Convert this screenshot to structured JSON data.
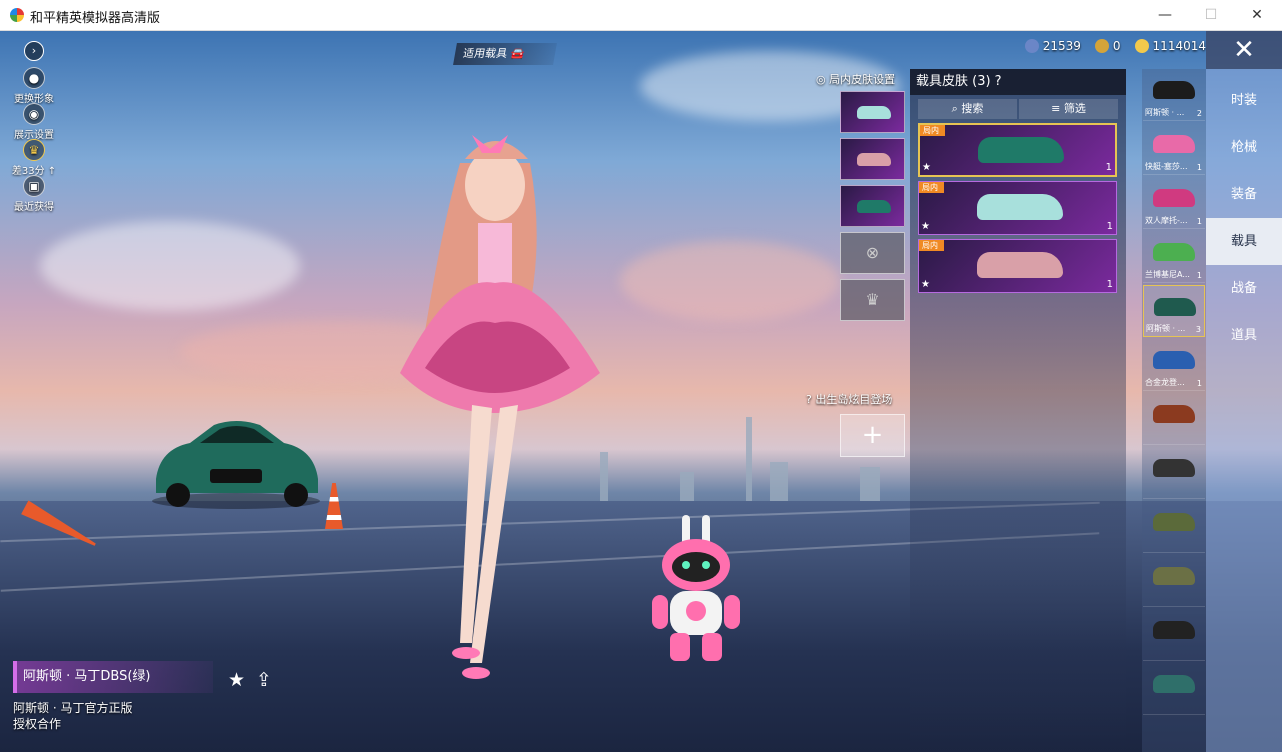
{
  "window": {
    "title": "和平精英模拟器高清版",
    "minimize": "—",
    "maximize": "☐",
    "close": "✕"
  },
  "left_menu": [
    {
      "label": "更换形象",
      "icon": "person-icon"
    },
    {
      "label": "展示设置",
      "icon": "eye-icon"
    },
    {
      "label": "差33分 ↑",
      "icon": "rank-badge-icon"
    },
    {
      "label": "最近获得",
      "icon": "gift-icon"
    }
  ],
  "apply_vehicle_label": "适用载具",
  "currency": {
    "a": "21539",
    "b": "0",
    "c": "1114014"
  },
  "categories": [
    "时装",
    "枪械",
    "装备",
    "载具",
    "战备",
    "道具"
  ],
  "active_category": "载具",
  "vehicle_list": [
    {
      "name": "阿斯顿 · ...",
      "count": "2",
      "color": "#1c1c1c"
    },
    {
      "name": "快艇-塞莎...",
      "count": "1",
      "color": "#e86aa8"
    },
    {
      "name": "双人摩托-...",
      "count": "1",
      "color": "#d03a80"
    },
    {
      "name": "兰博基尼A...",
      "count": "1",
      "color": "#4caf50"
    },
    {
      "name": "阿斯顿 · ...",
      "count": "3",
      "color": "#1f5a4e"
    },
    {
      "name": "合金龙登...",
      "count": "1",
      "color": "#2a5fb0"
    },
    {
      "name": "",
      "count": "",
      "color": "#8b3a1f"
    },
    {
      "name": "",
      "count": "",
      "color": "#333333"
    },
    {
      "name": "",
      "count": "",
      "color": "#5b6a3a"
    },
    {
      "name": "",
      "count": "",
      "color": "#6b7045"
    },
    {
      "name": "",
      "count": "",
      "color": "#222222"
    },
    {
      "name": "",
      "count": "",
      "color": "#2f6f6a"
    }
  ],
  "skin_panel": {
    "title": "载具皮肤 (3) ?",
    "search": "搜索",
    "filter": "筛选",
    "skins": [
      {
        "tag": "局内",
        "count": "1",
        "color": "#1f7a68"
      },
      {
        "tag": "局内",
        "count": "1",
        "color": "#a8e0dc"
      },
      {
        "tag": "局内",
        "count": "1",
        "color": "#d9a0a8"
      }
    ]
  },
  "in_battle_label": "局内皮肤设置",
  "in_battle_slots": [
    "#a8e0dc",
    "#d9a0a8",
    "#1f7a68"
  ],
  "spawn_label": "出生岛炫目登场",
  "add_symbol": "+",
  "vehicle_name": "阿斯顿 · 马丁DBS(绿)",
  "license_text": "阿斯顿 · 马丁官方正版\n授权合作"
}
